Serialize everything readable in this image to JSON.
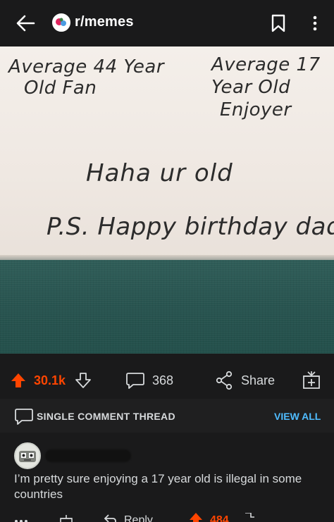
{
  "header": {
    "subreddit": "r/memes",
    "back_icon": "arrow-left-icon",
    "bookmark_icon": "bookmark-icon",
    "more_icon": "more-vertical-icon"
  },
  "post_image": {
    "note_top_left_line1": "Average 44 Year",
    "note_top_left_line2": "Old Fan",
    "note_top_right_line1": "Average 17",
    "note_top_right_line2": "Year Old",
    "note_top_right_line3": "Enjoyer",
    "note_middle": "Haha ur old",
    "note_ps": "P.S. Happy birthday dad"
  },
  "actions": {
    "score": "30.1k",
    "comments": "368",
    "share_label": "Share",
    "score_color": "#ff4500"
  },
  "thread": {
    "label": "SINGLE COMMENT THREAD",
    "view_all": "VIEW ALL",
    "link_color": "#4fbcff"
  },
  "comment": {
    "text": "I’m pretty sure enjoying a 17 year old is illegal in some countries",
    "reply_label": "Reply",
    "score": "484"
  }
}
